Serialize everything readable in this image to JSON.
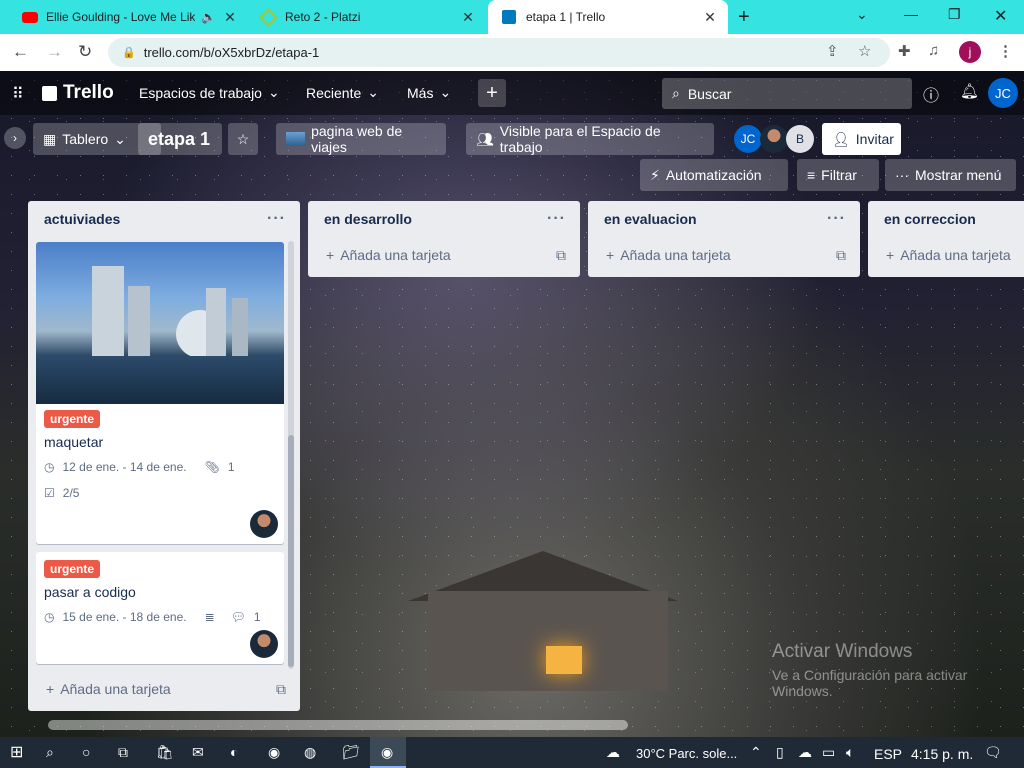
{
  "browser": {
    "tabs": [
      {
        "title": "Ellie Goulding - Love Me Like",
        "icon": "youtube-icon",
        "color": "#ff0000"
      },
      {
        "title": "Reto 2 - Platzi",
        "icon": "platzi-icon",
        "color": "#98ca3f"
      },
      {
        "title": "etapa 1 | Trello",
        "icon": "trello-icon",
        "color": "#0079bf"
      }
    ],
    "url": "trello.com/b/oX5xbrDz/etapa-1",
    "profile_initial": "j"
  },
  "trello": {
    "logo": "Trello",
    "nav": {
      "workspaces": "Espacios de trabajo",
      "recent": "Reciente",
      "more": "Más"
    },
    "search_placeholder": "Buscar",
    "user_initials": "JC"
  },
  "board": {
    "view": "Tablero",
    "name": "etapa 1",
    "workspace": "pagina web de viajes",
    "visibility": "Visible para el Espacio de trabajo",
    "members": [
      "JC",
      "",
      "B"
    ],
    "invite": "Invitar",
    "automation": "Automatización",
    "filter": "Filtrar",
    "menu": "Mostrar menú"
  },
  "lists": [
    {
      "title": "actuiviades",
      "add": "Añada una tarjeta",
      "cards": [
        {
          "label": "urgente",
          "title": "maquetar",
          "dates": "12 de ene. - 14 de ene.",
          "attachments": "1",
          "checklist": "2/5"
        },
        {
          "label": "urgente",
          "title": "pasar a codigo",
          "dates": "15 de ene. - 18 de ene.",
          "comments": "1"
        }
      ]
    },
    {
      "title": "en desarrollo",
      "add": "Añada una tarjeta"
    },
    {
      "title": "en evaluacion",
      "add": "Añada una tarjeta"
    },
    {
      "title": "en correccion",
      "add": "Añada una tarjeta"
    }
  ],
  "windows": {
    "activate_title": "Activar Windows",
    "activate_sub": "Ve a Configuración para activar",
    "activate_sub2": "Windows."
  },
  "taskbar": {
    "weather": "30°C  Parc. sole...",
    "lang": "ESP",
    "time": "4:15 p. m."
  },
  "colors": {
    "accent_red": "#eb5a46",
    "trello_blue": "#0079bf"
  }
}
